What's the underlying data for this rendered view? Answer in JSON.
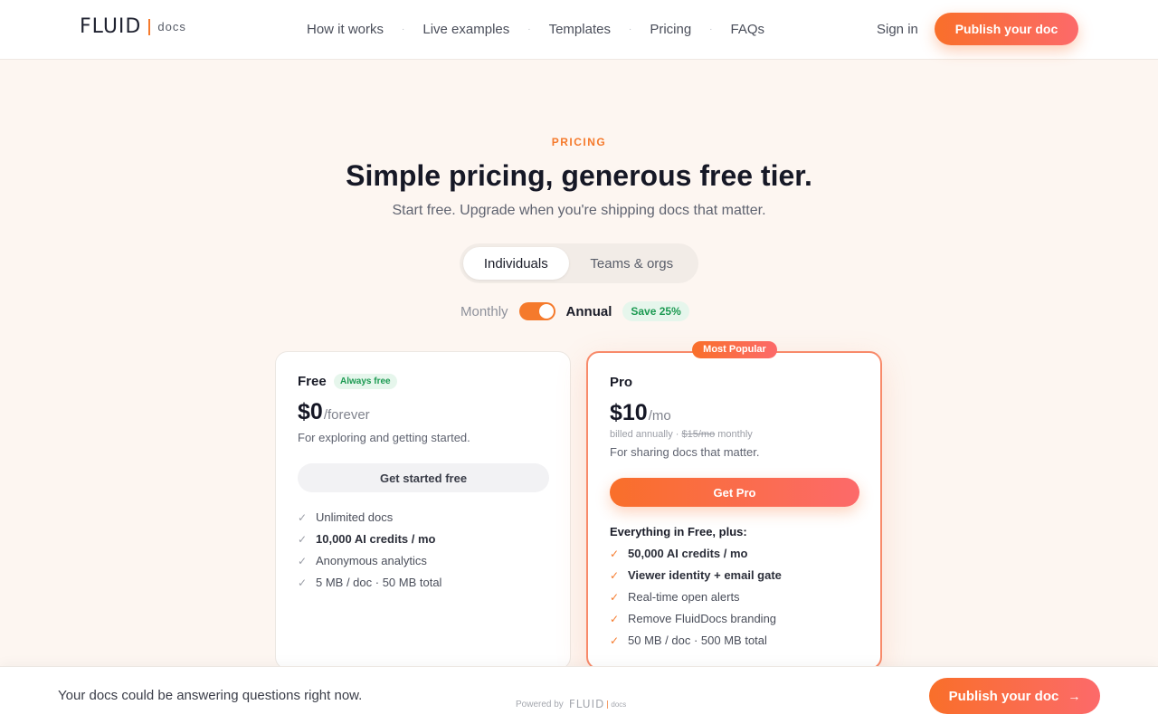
{
  "header": {
    "logo_word": "FLUID",
    "logo_suffix": "docs",
    "nav": [
      "How it works",
      "Live examples",
      "Templates",
      "Pricing",
      "FAQs"
    ],
    "nav_separator": "·",
    "signin": "Sign in",
    "publish": "Publish your doc"
  },
  "hero": {
    "eyebrow": "PRICING",
    "title": "Simple pricing, generous free tier.",
    "subtitle": "Start free. Upgrade when you're shipping docs that matter."
  },
  "audience_tabs": {
    "active": "Individuals",
    "inactive": "Teams & orgs"
  },
  "billing": {
    "monthly": "Monthly",
    "annual": "Annual",
    "save": "Save 25%",
    "annual_selected": true
  },
  "plans": {
    "free": {
      "name": "Free",
      "badge": "Always free",
      "price": "$0",
      "period": "/forever",
      "desc": "For exploring and getting started.",
      "cta": "Get started free",
      "features": [
        "Unlimited docs",
        "10,000 AI credits / mo",
        "Anonymous analytics",
        "5 MB / doc · 50 MB total"
      ]
    },
    "pro": {
      "flag": "Most Popular",
      "name": "Pro",
      "price": "$10",
      "period": "/mo",
      "billed_prefix": "billed annually · ",
      "billed_strike": "$15/mo",
      "billed_suffix": " monthly",
      "desc": "For sharing docs that matter.",
      "cta": "Get Pro",
      "plus_label": "Everything in Free, plus:",
      "features": [
        "50,000 AI credits / mo",
        "Viewer identity + email gate",
        "Real-time open alerts",
        "Remove FluidDocs branding",
        "50 MB / doc · 500 MB total"
      ]
    }
  },
  "bottom_bar": {
    "text": "Your docs could be answering questions right now.",
    "powered_by": "Powered by",
    "powered_word": "FLUID",
    "powered_docs": "docs",
    "publish": "Publish your doc"
  },
  "icons": {
    "check": "check-icon",
    "arrow": "arrow-right-icon"
  },
  "colors": {
    "accent": "#f57a2c",
    "accent_gradient_end": "#fc6a6a",
    "success": "#1c9a52",
    "background": "#fdf6f1"
  }
}
